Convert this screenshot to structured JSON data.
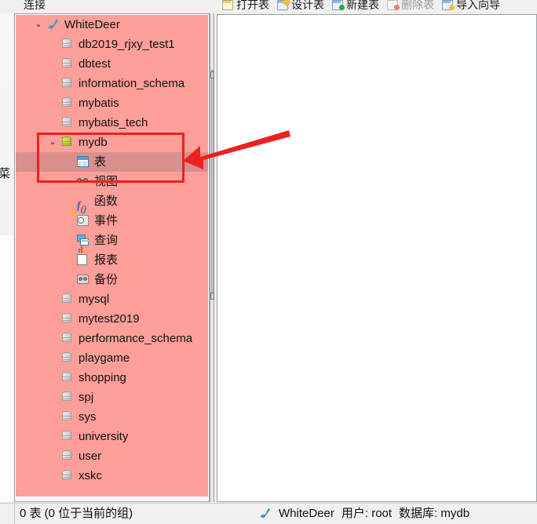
{
  "window": {
    "panel_title": "连接"
  },
  "toolbar": {
    "items": [
      {
        "label": "打开表",
        "icon": "open-table-icon",
        "disabled": false
      },
      {
        "label": "设计表",
        "icon": "design-table-icon",
        "disabled": false
      },
      {
        "label": "新建表",
        "icon": "new-table-icon",
        "disabled": false
      },
      {
        "label": "删除表",
        "icon": "delete-table-icon",
        "disabled": true
      },
      {
        "label": "导入向导",
        "icon": "import-wizard-icon",
        "disabled": false
      }
    ]
  },
  "stray": {
    "clipped_menu_char": "菜"
  },
  "tree": {
    "nodes": [
      {
        "label": "WhiteDeer",
        "icon": "connection-icon",
        "depth": 0,
        "chevron": "expanded",
        "selected": false
      },
      {
        "label": "db2019_rjxy_test1",
        "icon": "database-icon",
        "depth": 1,
        "chevron": "none",
        "selected": false
      },
      {
        "label": "dbtest",
        "icon": "database-icon",
        "depth": 1,
        "chevron": "none",
        "selected": false
      },
      {
        "label": "information_schema",
        "icon": "database-icon",
        "depth": 1,
        "chevron": "none",
        "selected": false
      },
      {
        "label": "mybatis",
        "icon": "database-icon",
        "depth": 1,
        "chevron": "none",
        "selected": false
      },
      {
        "label": "mybatis_tech",
        "icon": "database-icon",
        "depth": 1,
        "chevron": "none",
        "selected": false
      },
      {
        "label": "mydb",
        "icon": "database-open-icon",
        "depth": 1,
        "chevron": "expanded",
        "selected": false
      },
      {
        "label": "表",
        "icon": "table-icon",
        "depth": 2,
        "chevron": "none",
        "selected": true
      },
      {
        "label": "视图",
        "icon": "view-icon",
        "depth": 2,
        "chevron": "none",
        "selected": false
      },
      {
        "label": "函数",
        "icon": "function-icon",
        "depth": 2,
        "chevron": "none",
        "selected": false
      },
      {
        "label": "事件",
        "icon": "event-icon",
        "depth": 2,
        "chevron": "none",
        "selected": false
      },
      {
        "label": "查询",
        "icon": "query-icon",
        "depth": 2,
        "chevron": "none",
        "selected": false
      },
      {
        "label": "报表",
        "icon": "report-icon",
        "depth": 2,
        "chevron": "none",
        "selected": false
      },
      {
        "label": "备份",
        "icon": "backup-icon",
        "depth": 2,
        "chevron": "none",
        "selected": false
      },
      {
        "label": "mysql",
        "icon": "database-icon",
        "depth": 1,
        "chevron": "none",
        "selected": false
      },
      {
        "label": "mytest2019",
        "icon": "database-icon",
        "depth": 1,
        "chevron": "none",
        "selected": false
      },
      {
        "label": "performance_schema",
        "icon": "database-icon",
        "depth": 1,
        "chevron": "none",
        "selected": false
      },
      {
        "label": "playgame",
        "icon": "database-icon",
        "depth": 1,
        "chevron": "none",
        "selected": false
      },
      {
        "label": "shopping",
        "icon": "database-icon",
        "depth": 1,
        "chevron": "none",
        "selected": false
      },
      {
        "label": "spj",
        "icon": "database-icon",
        "depth": 1,
        "chevron": "none",
        "selected": false
      },
      {
        "label": "sys",
        "icon": "database-icon",
        "depth": 1,
        "chevron": "none",
        "selected": false
      },
      {
        "label": "university",
        "icon": "database-icon",
        "depth": 1,
        "chevron": "none",
        "selected": false
      },
      {
        "label": "user",
        "icon": "database-icon",
        "depth": 1,
        "chevron": "none",
        "selected": false
      },
      {
        "label": "xskc",
        "icon": "database-icon",
        "depth": 1,
        "chevron": "none",
        "selected": false
      }
    ]
  },
  "statusbar": {
    "left_text": "0 表 (0 位于当前的组)",
    "connection_icon": "connection-icon",
    "connection_name": "WhiteDeer",
    "user_text": "用户: root",
    "database_text": "数据库: mydb"
  },
  "colors": {
    "tree_background": "#ff9f99",
    "tree_selected": "#d98f8c",
    "annotation_red": "#ee2020",
    "panel_background": "#f0f0f0",
    "content_background": "#ffffff"
  },
  "annotations": {
    "highlight_box": "red-rectangle-around-mydb-tables",
    "pointer": "red-arrow-pointing-to-tables-node"
  }
}
